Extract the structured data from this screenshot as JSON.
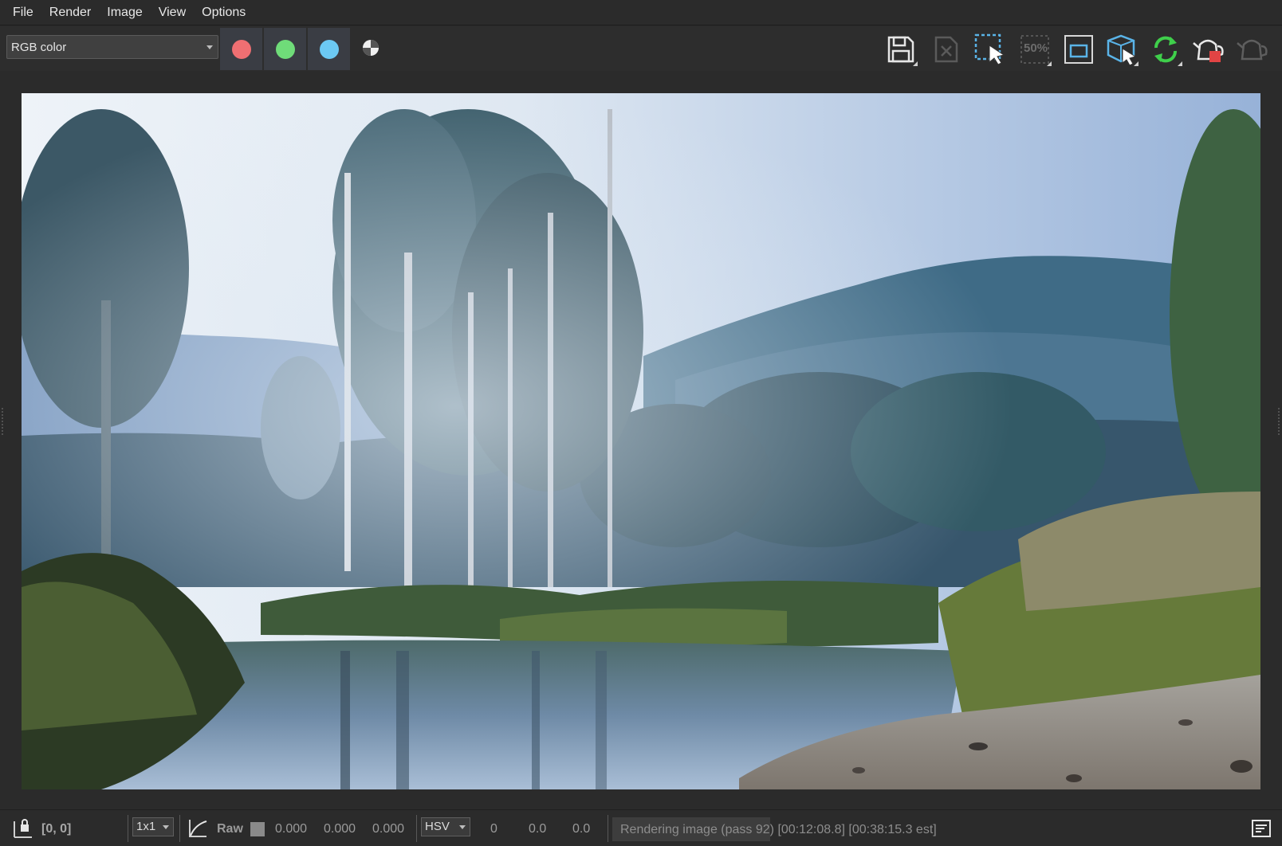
{
  "menu": [
    "File",
    "Render",
    "Image",
    "View",
    "Options"
  ],
  "toolbar": {
    "channel_select": "RGB color",
    "channels": [
      {
        "name": "red-channel",
        "color": "#ef6f72"
      },
      {
        "name": "green-channel",
        "color": "#6fdc79"
      },
      {
        "name": "blue-channel",
        "color": "#6cc9f3"
      }
    ],
    "icons": [
      "save-image-icon",
      "clear-image-icon",
      "region-select-icon",
      "fifty-percent-icon",
      "frame-icon",
      "pick-object-icon",
      "refresh-icon",
      "render-teapot-icon",
      "teapot-disabled-icon"
    ],
    "fifty_percent_label": "50%"
  },
  "status": {
    "coords": "[0, 0]",
    "zoom": "1x1",
    "raw_label": "Raw",
    "rgb_values": [
      "0.000",
      "0.000",
      "0.000"
    ],
    "color_mode": "HSV",
    "hsv_values": [
      "0",
      "0.0",
      "0.0"
    ],
    "progress_text": "Rendering image (pass 92) [00:12:08.8] [00:38:15.3 est]",
    "progress_fraction": 0.32
  },
  "colors": {
    "menu_bg": "#2b2b2b",
    "channel_btn_bg": "#3a3d44",
    "accent_blue": "#5ab4e8",
    "accent_green": "#3fcf4b",
    "accent_red": "#e24444"
  }
}
